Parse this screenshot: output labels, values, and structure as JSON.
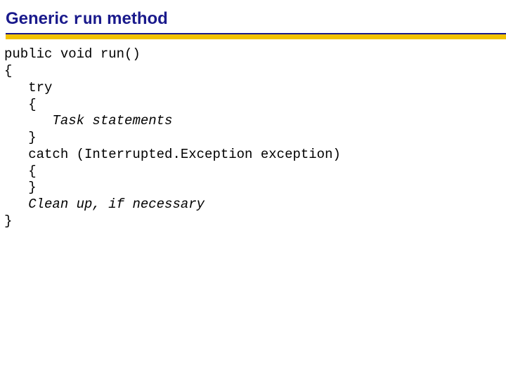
{
  "title": {
    "part1": "Generic ",
    "mono": "run",
    "part2": " method"
  },
  "code": {
    "l1": "public void run()",
    "l2": "{",
    "l3": "   try",
    "l4": "   {",
    "l5_indent": "      ",
    "l5_italic": "Task statements",
    "l6": "   }",
    "l7": "   catch (Interrupted.Exception exception)",
    "l8": "   {",
    "l9": "   }",
    "l10_indent": "   ",
    "l10_italic": "Clean up, if necessary",
    "l11": "}"
  }
}
